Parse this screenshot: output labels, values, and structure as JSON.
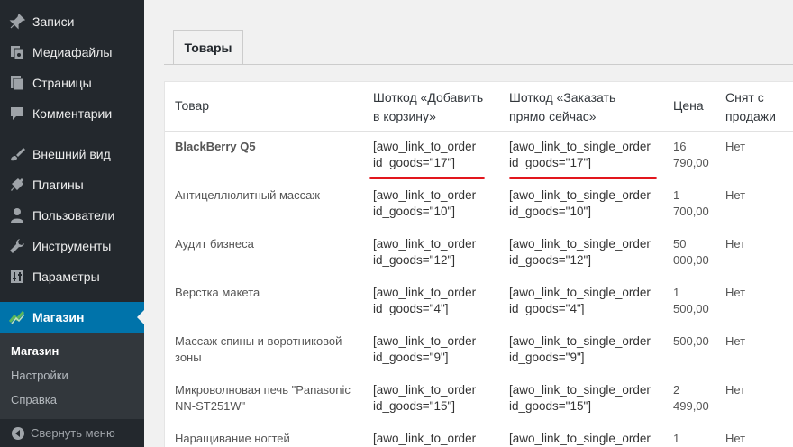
{
  "sidebar": {
    "items": [
      {
        "label": "Записи",
        "icon": "pin-icon"
      },
      {
        "label": "Медиафайлы",
        "icon": "media-icon"
      },
      {
        "label": "Страницы",
        "icon": "pages-icon"
      },
      {
        "label": "Комментарии",
        "icon": "comments-icon"
      },
      {
        "label": "Внешний вид",
        "icon": "appearance-icon"
      },
      {
        "label": "Плагины",
        "icon": "plugins-icon"
      },
      {
        "label": "Пользователи",
        "icon": "users-icon"
      },
      {
        "label": "Инструменты",
        "icon": "tools-icon"
      },
      {
        "label": "Параметры",
        "icon": "settings-icon"
      },
      {
        "label": "Магазин",
        "icon": "shop-icon"
      }
    ],
    "submenu": [
      "Магазин",
      "Настройки",
      "Справка"
    ],
    "collapse_label": "Свернуть меню"
  },
  "tab": {
    "label": "Товары"
  },
  "table": {
    "headers": {
      "product": "Товар",
      "add_to_cart_l1": "Шоткод «Добавить",
      "add_to_cart_l2": "в корзину»",
      "order_now_l1": "Шоткод «Заказать",
      "order_now_l2": "прямо сейчас»",
      "price": "Цена",
      "removed_l1": "Снят с",
      "removed_l2": "продажи"
    },
    "rows": [
      {
        "name_l1": "BlackBerry Q5",
        "name_l2": "",
        "code1_l1": "[awo_link_to_order",
        "code1_l2": "id_goods=\"17\"]",
        "code2_l1": "[awo_link_to_single_order",
        "code2_l2": "id_goods=\"17\"]",
        "price_l1": "16",
        "price_l2": "790,00",
        "removed": "Нет"
      },
      {
        "name_l1": "Антицеллюлитный массаж",
        "name_l2": "",
        "code1_l1": "[awo_link_to_order",
        "code1_l2": "id_goods=\"10\"]",
        "code2_l1": "[awo_link_to_single_order",
        "code2_l2": "id_goods=\"10\"]",
        "price_l1": "1",
        "price_l2": "700,00",
        "removed": "Нет"
      },
      {
        "name_l1": "Аудит бизнеса",
        "name_l2": "",
        "code1_l1": "[awo_link_to_order",
        "code1_l2": "id_goods=\"12\"]",
        "code2_l1": "[awo_link_to_single_order",
        "code2_l2": "id_goods=\"12\"]",
        "price_l1": "50",
        "price_l2": "000,00",
        "removed": "Нет"
      },
      {
        "name_l1": "Верстка макета",
        "name_l2": "",
        "code1_l1": "[awo_link_to_order",
        "code1_l2": "id_goods=\"4\"]",
        "code2_l1": "[awo_link_to_single_order",
        "code2_l2": "id_goods=\"4\"]",
        "price_l1": "1",
        "price_l2": "500,00",
        "removed": "Нет"
      },
      {
        "name_l1": "Массаж спины и воротниковой",
        "name_l2": "зоны",
        "code1_l1": "[awo_link_to_order",
        "code1_l2": "id_goods=\"9\"]",
        "code2_l1": "[awo_link_to_single_order",
        "code2_l2": "id_goods=\"9\"]",
        "price_l1": "500,00",
        "price_l2": "",
        "removed": "Нет"
      },
      {
        "name_l1": "Микроволновая печь \"Panasonic",
        "name_l2": "NN-ST251W\"",
        "code1_l1": "[awo_link_to_order",
        "code1_l2": "id_goods=\"15\"]",
        "code2_l1": "[awo_link_to_single_order",
        "code2_l2": "id_goods=\"15\"]",
        "price_l1": "2",
        "price_l2": "499,00",
        "removed": "Нет"
      },
      {
        "name_l1": "Наращивание ногтей",
        "name_l2": "",
        "code1_l1": "[awo_link_to_order",
        "code1_l2": "",
        "code2_l1": "[awo_link_to_single_order",
        "code2_l2": "",
        "price_l1": "1",
        "price_l2": "",
        "removed": "Нет"
      }
    ]
  },
  "colors": {
    "sidebar_bg": "#23282d",
    "active_bg": "#0073aa",
    "highlight": "#e2161d"
  }
}
